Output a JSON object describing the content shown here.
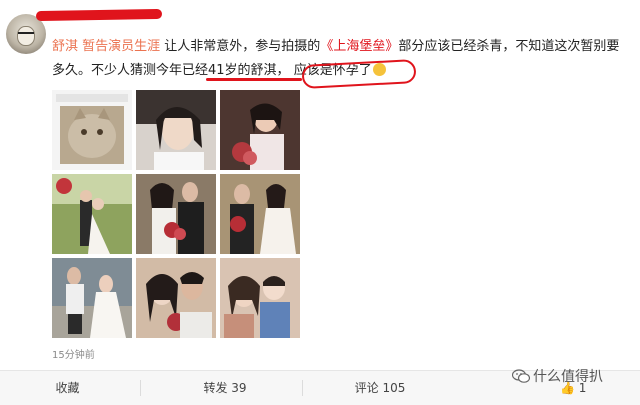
{
  "post": {
    "user_name": "舒淇",
    "mention": "暂告演员生涯",
    "text_part1": " 让人非常意外，参与拍摄的",
    "movie_tag": "《上海堡垒》",
    "text_part2": "部分应该已经杀青，不知道这次暂别要多久。不少人猜测今年已经41岁的舒淇，",
    "circled_text": "应该是怀孕了",
    "time": "15分钟前"
  },
  "images": [
    {
      "name": "cat-photo",
      "palette": [
        "#e9e9e9",
        "#a18f77"
      ]
    },
    {
      "name": "portrait-smile",
      "palette": [
        "#3a3a3a",
        "#e8d6c6"
      ]
    },
    {
      "name": "bride-bouquet",
      "palette": [
        "#5a3c33",
        "#c98a8a"
      ]
    },
    {
      "name": "wedding-park",
      "palette": [
        "#7c8f4a",
        "#f2eee6"
      ]
    },
    {
      "name": "couple-roses-1",
      "palette": [
        "#7b6b5a",
        "#1f1f1f"
      ]
    },
    {
      "name": "couple-roses-2",
      "palette": [
        "#9e8a6c",
        "#2a2a2a"
      ]
    },
    {
      "name": "couple-beach",
      "palette": [
        "#6d7b86",
        "#f4f4f4"
      ]
    },
    {
      "name": "couple-selfie",
      "palette": [
        "#c9ad95",
        "#e7ddd6"
      ]
    },
    {
      "name": "woman-child",
      "palette": [
        "#cfa993",
        "#5577aa"
      ]
    }
  ],
  "actions": {
    "favorite": "收藏",
    "repost": "转发 39",
    "comment": "评论 105",
    "like": "1"
  },
  "watermark": {
    "text": "什么值得扒"
  },
  "colors": {
    "accent": "#eb7350",
    "annotation_red": "#e0141c"
  }
}
